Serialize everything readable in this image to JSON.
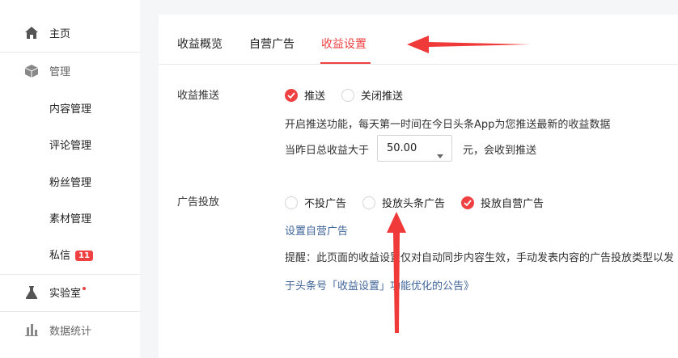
{
  "sidebar": {
    "items": [
      {
        "label": "主页",
        "icon": "home-icon"
      },
      {
        "label": "管理",
        "icon": "cube-icon"
      },
      {
        "label": "内容管理"
      },
      {
        "label": "评论管理"
      },
      {
        "label": "粉丝管理"
      },
      {
        "label": "素材管理"
      },
      {
        "label": "私信",
        "badge": "11"
      },
      {
        "label": "实验室",
        "icon": "flask-icon"
      },
      {
        "label": "数据统计",
        "icon": "bar-chart-icon"
      }
    ]
  },
  "tabs": [
    "收益概览",
    "自营广告",
    "收益设置"
  ],
  "active_tab": "收益设置",
  "push": {
    "label": "收益推送",
    "options": [
      "推送",
      "关闭推送"
    ],
    "selected": "推送",
    "description": "开启推送功能，每天第一时间在今日头条App为您推送最新的收益数据",
    "threshold_prefix": "当昨日总收益大于",
    "threshold_value": "50.00",
    "threshold_suffix": "元，会收到推送"
  },
  "ads": {
    "label": "广告投放",
    "options": [
      "不投广告",
      "投放头条广告",
      "投放自营广告"
    ],
    "selected": "投放自营广告",
    "self_ad_link": "设置自营广告",
    "notice": "提醒：此页面的收益设置仅对自动同步内容生效，手动发表内容的广告投放类型以发",
    "announcement_link": "于头条号「收益设置」功能优化的公告》"
  },
  "colors": {
    "accent": "#f04142",
    "link": "#406599",
    "annotation": "#f03a3a"
  }
}
